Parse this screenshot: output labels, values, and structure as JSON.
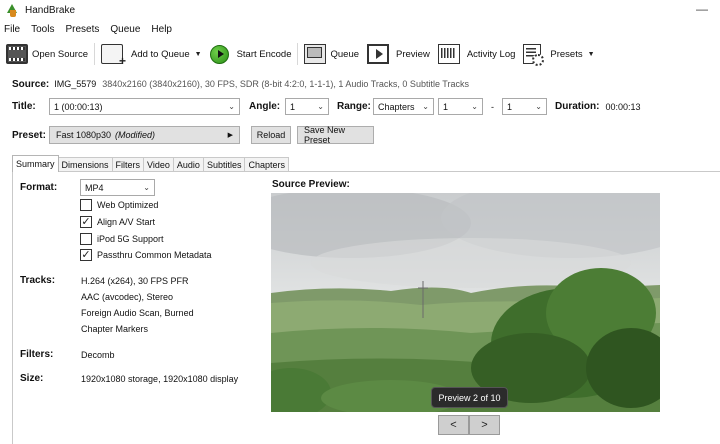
{
  "window": {
    "title": "HandBrake",
    "controls": "—"
  },
  "menu": [
    "File",
    "Tools",
    "Presets",
    "Queue",
    "Help"
  ],
  "toolbar": {
    "open_source": "Open Source",
    "add_to_queue": "Add to Queue",
    "start_encode": "Start Encode",
    "queue": "Queue",
    "preview": "Preview",
    "activity_log": "Activity Log",
    "presets": "Presets"
  },
  "source": {
    "label": "Source:",
    "name": "IMG_5579",
    "info": "3840x2160 (3840x2160), 30 FPS, SDR (8-bit 4:2:0, 1-1-1), 1 Audio Tracks, 0 Subtitle Tracks"
  },
  "title_row": {
    "title_label": "Title:",
    "title_value": "1  (00:00:13)",
    "angle_label": "Angle:",
    "angle_value": "1",
    "range_label": "Range:",
    "range_value": "Chapters",
    "range_start": "1",
    "range_dash": "-",
    "range_end": "1",
    "duration_label": "Duration:",
    "duration_value": "00:00:13"
  },
  "preset": {
    "label": "Preset:",
    "name": "Fast 1080p30",
    "modified": "(Modified)",
    "reload": "Reload",
    "save_new": "Save New Preset"
  },
  "tabs": [
    "Summary",
    "Dimensions",
    "Filters",
    "Video",
    "Audio",
    "Subtitles",
    "Chapters"
  ],
  "active_tab": "Summary",
  "summary": {
    "format_label": "Format:",
    "format_value": "MP4",
    "options": [
      {
        "label": "Web Optimized",
        "checked": false
      },
      {
        "label": "Align A/V Start",
        "checked": true
      },
      {
        "label": "iPod 5G Support",
        "checked": false
      },
      {
        "label": "Passthru Common Metadata",
        "checked": true
      }
    ],
    "tracks_label": "Tracks:",
    "tracks": [
      "H.264 (x264), 30 FPS PFR",
      "AAC (avcodec), Stereo",
      "Foreign Audio Scan, Burned",
      "Chapter Markers"
    ],
    "filters_label": "Filters:",
    "filters_value": "Decomb",
    "size_label": "Size:",
    "size_value": "1920x1080 storage, 1920x1080 display"
  },
  "preview": {
    "title": "Source Preview:",
    "badge": "Preview 2 of 10",
    "prev": "<",
    "next": ">"
  },
  "check_mark": "✓",
  "chevron": "⌄"
}
